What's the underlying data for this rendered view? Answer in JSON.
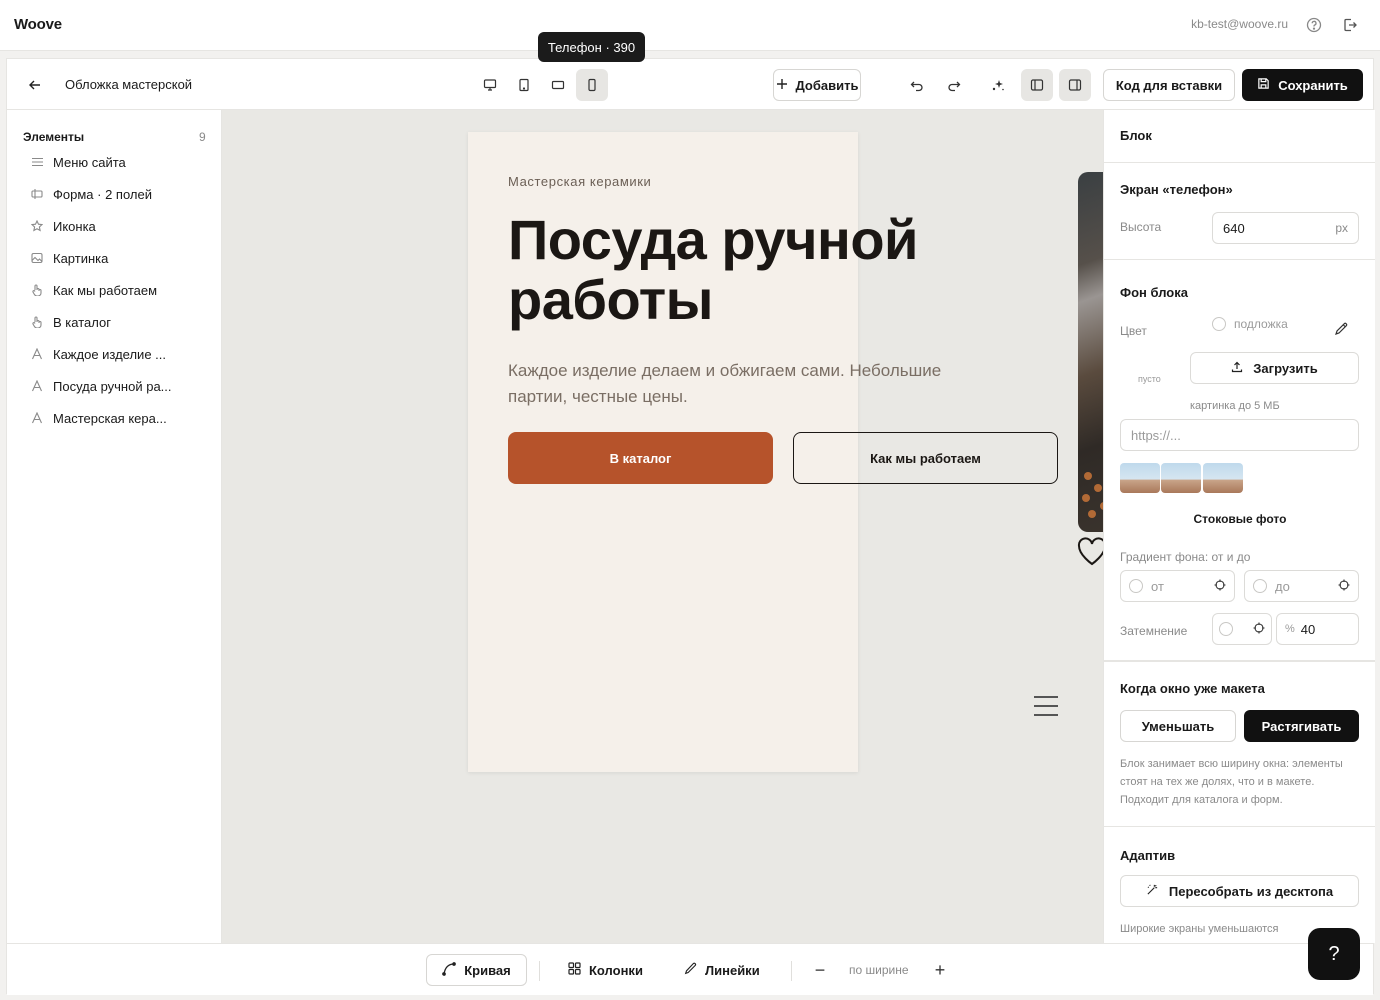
{
  "app": {
    "brand": "Woove",
    "email": "kb-test@woove.ru"
  },
  "tooltip": "Телефон · 390",
  "toolbar": {
    "title": "Обложка мастерской",
    "add_label": "Добавить",
    "embed_label": "Код для вставки",
    "save_label": "Сохранить"
  },
  "sidebar": {
    "heading": "Элементы",
    "count": "9",
    "items": [
      {
        "label": "Меню сайта",
        "icon": "menu-icon"
      },
      {
        "label": "Форма · 2 полей",
        "icon": "form-icon"
      },
      {
        "label": "Иконка",
        "icon": "star-icon"
      },
      {
        "label": "Картинка",
        "icon": "image-icon"
      },
      {
        "label": "Как мы работаем",
        "icon": "pointer-icon"
      },
      {
        "label": "В каталог",
        "icon": "pointer-icon"
      },
      {
        "label": "Каждое изделие ...",
        "icon": "text-icon"
      },
      {
        "label": "Посуда ручной ра...",
        "icon": "text-icon"
      },
      {
        "label": "Мастерская кера...",
        "icon": "text-icon"
      }
    ]
  },
  "canvas": {
    "kicker": "Мастерская керамики",
    "hero": "Посуда ручной работы",
    "lead": "Каждое изделие делаем и обжигаем сами. Небольшие партии, честные цены.",
    "cta_primary": "В каталог",
    "cta_secondary": "Как мы работаем",
    "accent_color": "#b6532b",
    "background_color": "#f5f0ea"
  },
  "panel": {
    "block_title": "Блок",
    "screen_title": "Экран «телефон»",
    "height_label": "Высота",
    "height_value": "640",
    "height_unit": "px",
    "bg_title": "Фон блока",
    "color_label": "Цвет",
    "color_placeholder": "подложка",
    "empty_label": "пусто",
    "upload_label": "Загрузить",
    "upload_hint": "картинка до 5 МБ",
    "url_placeholder": "https://...",
    "stock_label": "Стоковые фото",
    "gradient_label": "Градиент фона: от и до",
    "gradient_from": "от",
    "gradient_to": "до",
    "dim_label": "Затемнение",
    "dim_unit": "%",
    "dim_value": "40",
    "window_title": "Когда окно уже макета",
    "shrink_label": "Уменьшать",
    "stretch_label": "Растягивать",
    "window_hint": "Блок занимает всю ширину окна: элементы стоят на тех же долях, что и в макете. Подходит для каталога и форм.",
    "adaptive_title": "Адаптив",
    "rebuild_label": "Пересобрать из десктопа",
    "adaptive_hint": "Широкие экраны уменьшаются"
  },
  "bottom": {
    "curve_label": "Кривая",
    "columns_label": "Колонки",
    "rulers_label": "Линейки",
    "zoom_label": "по ширине"
  },
  "help_label": "?"
}
